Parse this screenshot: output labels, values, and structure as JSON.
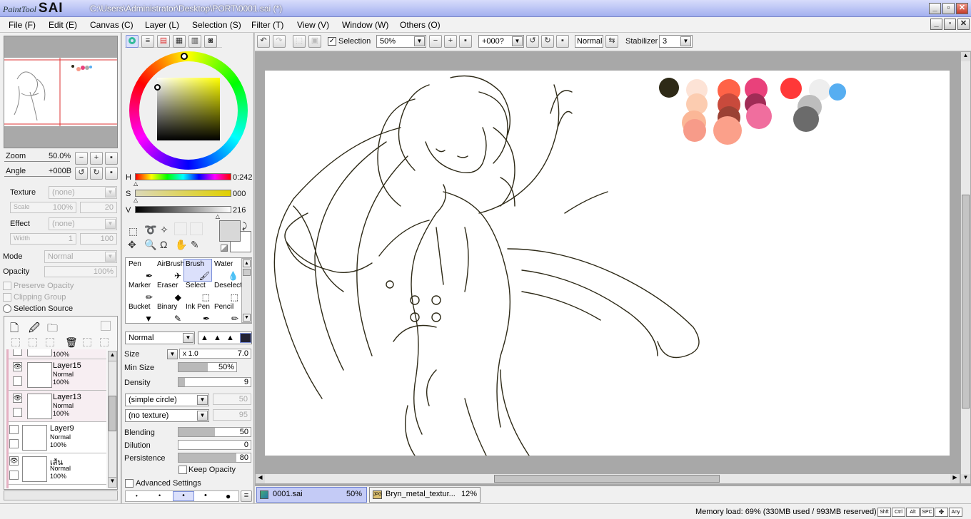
{
  "window": {
    "logo_small": "PaintTool",
    "logo_big": "SAI",
    "title": "C:\\Users\\Administrator\\Desktop\\PORT\\0001.sai (*)"
  },
  "menu": [
    "File (F)",
    "Edit (E)",
    "Canvas (C)",
    "Layer (L)",
    "Selection (S)",
    "Filter (T)",
    "View (V)",
    "Window (W)",
    "Others (O)"
  ],
  "navigator": {
    "zoom_label": "Zoom",
    "zoom_value": "50.0%",
    "angle_label": "Angle",
    "angle_value": "+000B"
  },
  "layer_props": {
    "texture_label": "Texture",
    "texture_value": "(none)",
    "scale_label": "Scale",
    "scale_value": "100%",
    "scale_num": "20",
    "effect_label": "Effect",
    "effect_value": "(none)",
    "width_label": "Width",
    "width_value": "1",
    "width_num": "100",
    "mode_label": "Mode",
    "mode_value": "Normal",
    "opacity_label": "Opacity",
    "opacity_value": "100%",
    "preserve_opacity": "Preserve Opacity",
    "clipping_group": "Clipping Group",
    "selection_source": "Selection Source"
  },
  "layers": [
    {
      "name": "",
      "mode": "",
      "opacity": "100%",
      "partial": true
    },
    {
      "name": "Layer15",
      "mode": "Normal",
      "opacity": "100%",
      "visible": true
    },
    {
      "name": "Layer13",
      "mode": "Normal",
      "opacity": "100%",
      "visible": true
    },
    {
      "name": "Layer9",
      "mode": "Normal",
      "opacity": "100%",
      "visible": false
    },
    {
      "name": "เส้น",
      "mode": "Normal",
      "opacity": "100%",
      "visible": true
    }
  ],
  "color": {
    "h_label": "H",
    "h_value": "0:242",
    "h_level": 0.0,
    "s_label": "S",
    "s_value": "000",
    "s_level": 0.0,
    "v_label": "V",
    "v_value": "216",
    "v_level": 0.85,
    "primary": "#d8d8d8",
    "secondary": "#ffffff"
  },
  "tools": [
    [
      "Pen",
      "AirBrush",
      "Brush",
      "Water"
    ],
    [
      "Marker",
      "Eraser",
      "Select",
      "Deselect"
    ],
    [
      "Bucket",
      "Binary",
      "Ink Pen",
      "Pencil"
    ]
  ],
  "selected_tool": "Brush",
  "brush": {
    "blend_mode": "Normal",
    "size_label": "Size",
    "size_mult": "x 1.0",
    "size_value": "7.0",
    "minsize_label": "Min Size",
    "minsize_value": "50%",
    "minsize_level": 0.5,
    "density_label": "Density",
    "density_value": "9",
    "density_level": 0.09,
    "shape": "(simple circle)",
    "shape_num": "50",
    "texture": "(no texture)",
    "texture_num": "95",
    "blending_label": "Blending",
    "blending_value": "50",
    "blending_level": 0.5,
    "dilution_label": "Dilution",
    "dilution_value": "0",
    "dilution_level": 0.0,
    "persistence_label": "Persistence",
    "persistence_value": "80",
    "persistence_level": 0.8,
    "keep_opacity": "Keep Opacity",
    "advanced": "Advanced Settings"
  },
  "toolbar": {
    "selection_label": "Selection",
    "zoom": "50%",
    "angle": "+000?",
    "blend": "Normal",
    "stabilizer_label": "Stabilizer",
    "stabilizer": "3"
  },
  "tabs": [
    {
      "name": "0001.sai",
      "zoom": "50%",
      "active": true
    },
    {
      "name": "Bryn_metal_textur...",
      "zoom": "12%",
      "active": false
    }
  ],
  "status": {
    "memory": "Memory load: 69% (330MB used / 993MB reserved)",
    "keys": [
      "Shft",
      "Ctrl",
      "Alt",
      "SPC",
      "",
      "Any"
    ]
  },
  "palette_colors": [
    "#2e2a17",
    "#fde3d6",
    "#ff6347",
    "#e9417b",
    "#ff3838",
    "#eeeeee",
    "#57aef1",
    "#fcccb0",
    "#c84a3c",
    "#a02c56",
    "#bdbdbd",
    "#fbb797",
    "#9b4134",
    "#f06e9e",
    "#6b6b6b",
    "#f79b89",
    "#fba08a"
  ]
}
